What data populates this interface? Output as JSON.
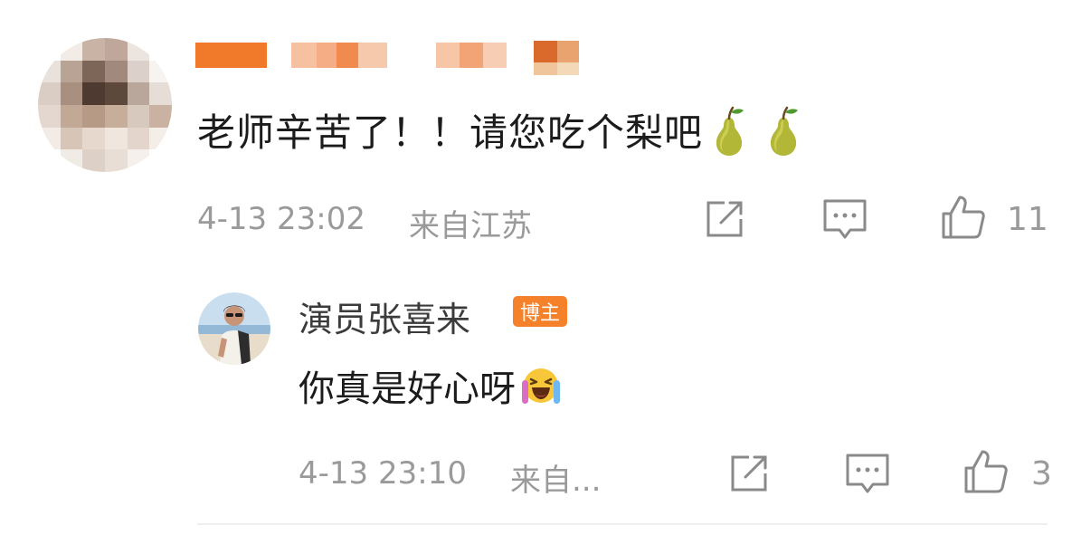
{
  "comment": {
    "text": "老师辛苦了！！请您吃个梨吧",
    "emojis": [
      "pear-emoji",
      "pear-emoji"
    ],
    "time": "4-13 23:02",
    "location": "来自江苏",
    "like_count": "11",
    "username_redacted": true,
    "avatar_redacted": true
  },
  "reply": {
    "username": "演员张喜来",
    "badge": "博主",
    "text": "你真是好心呀",
    "emoji": "laugh-cry-emoji",
    "time": "4-13 23:10",
    "location": "来自...",
    "like_count": "3"
  },
  "icons": {
    "forward": "share-edit-icon",
    "comment": "comment-icon",
    "like": "thumbs-up-icon"
  },
  "colors": {
    "badge": "#f5822a",
    "text": "#1c1c1c",
    "meta": "#9a9a9a",
    "username": "#3b3b3b"
  }
}
